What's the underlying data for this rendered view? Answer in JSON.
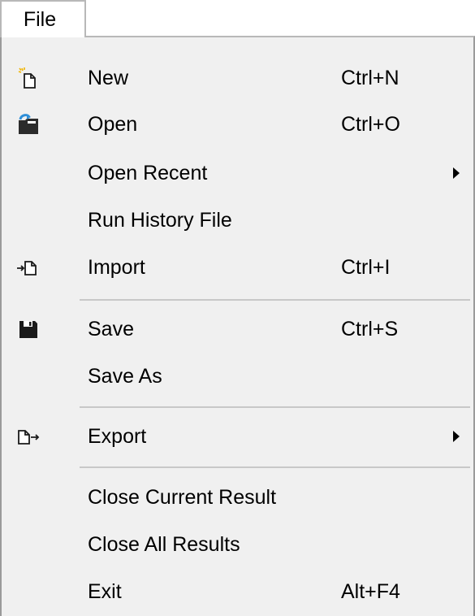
{
  "menubar": {
    "file_label": "File"
  },
  "menu": {
    "items": [
      {
        "label": "New",
        "shortcut": "Ctrl+N",
        "icon": "new-file-icon"
      },
      {
        "label": "Open",
        "shortcut": "Ctrl+O",
        "icon": "open-folder-icon"
      },
      {
        "label": "Open Recent",
        "shortcut": "",
        "icon": "",
        "submenu": true
      },
      {
        "label": "Run History File",
        "shortcut": "",
        "icon": ""
      },
      {
        "label": "Import",
        "shortcut": "Ctrl+I",
        "icon": "import-icon"
      },
      {
        "label": "Save",
        "shortcut": "Ctrl+S",
        "icon": "save-disk-icon"
      },
      {
        "label": "Save As",
        "shortcut": "",
        "icon": ""
      },
      {
        "label": "Export",
        "shortcut": "",
        "icon": "export-icon",
        "submenu": true
      },
      {
        "label": "Close Current Result",
        "shortcut": "",
        "icon": ""
      },
      {
        "label": "Close All Results",
        "shortcut": "",
        "icon": ""
      },
      {
        "label": "Exit",
        "shortcut": "Alt+F4",
        "icon": ""
      }
    ]
  },
  "colors": {
    "menu_background": "#f0f0f0",
    "separator": "#c8c8c8",
    "open_icon_blue": "#2f8fd8",
    "new_icon_yellow": "#f0b400"
  }
}
